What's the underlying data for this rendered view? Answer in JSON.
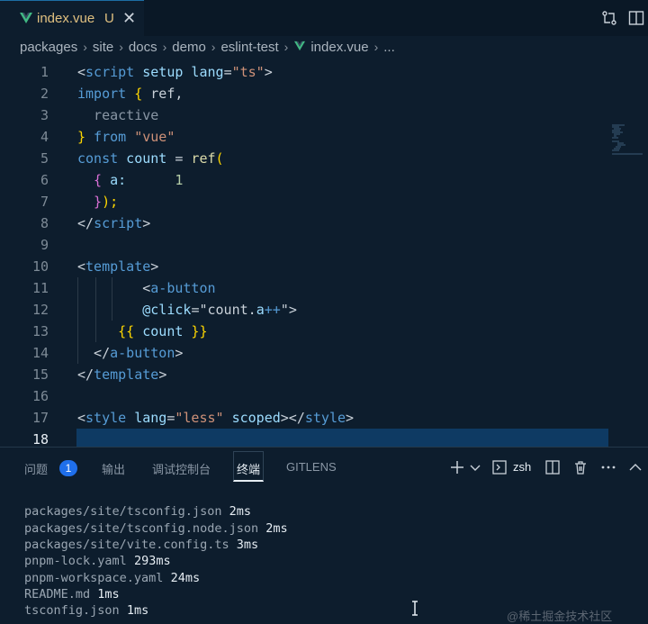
{
  "tab": {
    "filename": "index.vue",
    "status": "U",
    "close": "✕"
  },
  "breadcrumb": [
    "packages",
    "site",
    "docs",
    "demo",
    "eslint-test",
    "index.vue",
    "..."
  ],
  "breadcrumb_sep": "›",
  "editor": {
    "active_line": 18,
    "lines": [
      {
        "n": "1"
      },
      {
        "n": "2"
      },
      {
        "n": "3"
      },
      {
        "n": "4"
      },
      {
        "n": "5"
      },
      {
        "n": "6"
      },
      {
        "n": "7"
      },
      {
        "n": "8"
      },
      {
        "n": "9"
      },
      {
        "n": "10"
      },
      {
        "n": "11"
      },
      {
        "n": "12"
      },
      {
        "n": "13"
      },
      {
        "n": "14"
      },
      {
        "n": "15"
      },
      {
        "n": "16"
      },
      {
        "n": "17"
      },
      {
        "n": "18"
      }
    ],
    "code": {
      "l1": [
        "<",
        "script",
        " setup",
        " lang",
        "=",
        "\"ts\"",
        ">"
      ],
      "l2": [
        "import",
        " {",
        " ref,"
      ],
      "l3": [
        "  reactive"
      ],
      "l4": [
        "}",
        " from",
        " \"vue\""
      ],
      "l5": [
        "const",
        " count",
        " =",
        " ref",
        "("
      ],
      "l6": [
        "  {",
        " a:",
        "      1"
      ],
      "l7": [
        "  }",
        ");"
      ],
      "l8": [
        "</",
        "script",
        ">"
      ],
      "l10": [
        "<",
        "template",
        ">"
      ],
      "l11": [
        "        <",
        "a-button"
      ],
      "l12": [
        "        @click",
        "=",
        "\"count.",
        "a",
        "++",
        "\"",
        ">"
      ],
      "l13": [
        "     {{",
        " count",
        " }}"
      ],
      "l14": [
        "  </",
        "a-button",
        ">"
      ],
      "l15": [
        "</",
        "template",
        ">"
      ],
      "l17": [
        "<",
        "style",
        " lang",
        "=",
        "\"less\"",
        " scoped",
        "></",
        "style",
        ">"
      ]
    }
  },
  "panel": {
    "tabs": [
      "问题",
      "输出",
      "调试控制台",
      "终端",
      "GITLENS"
    ],
    "problems_count": "1",
    "shell": "zsh",
    "terminal_lines": [
      {
        "path": "packages/site/tsconfig.json",
        "time": "2ms"
      },
      {
        "path": "packages/site/tsconfig.node.json",
        "time": "2ms"
      },
      {
        "path": "packages/site/vite.config.ts",
        "time": "3ms"
      },
      {
        "path": "pnpm-lock.yaml",
        "time": "293ms"
      },
      {
        "path": "pnpm-workspace.yaml",
        "time": "24ms"
      },
      {
        "path": "README.md",
        "time": "1ms"
      },
      {
        "path": "tsconfig.json",
        "time": "1ms"
      }
    ]
  },
  "watermark": "@稀土掘金技术社区",
  "icons": [
    "vue-file-icon",
    "compare-icon",
    "split-editor-icon",
    "add-terminal-icon",
    "chevron-down-icon",
    "terminal-icon",
    "split-terminal-icon",
    "trash-icon",
    "more-icon",
    "chevron-up-icon"
  ],
  "colors": {
    "accent": "#1f6feb",
    "keyword": "#569cd6",
    "string": "#ce9178",
    "function": "#dcdcaa",
    "vue": "#41b883"
  }
}
